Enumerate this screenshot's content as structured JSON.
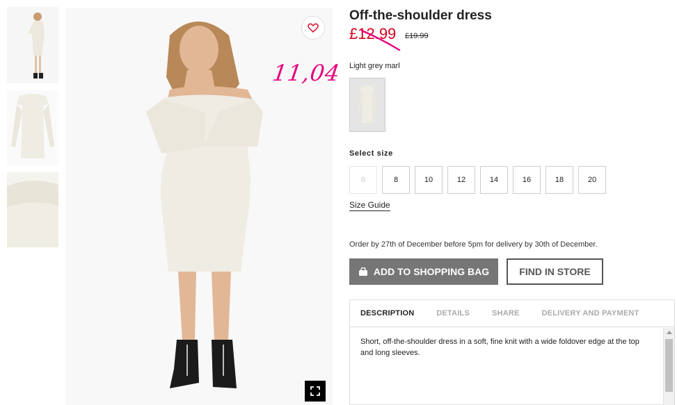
{
  "product": {
    "title": "Off-the-shoulder dress",
    "price_new": "£12.99",
    "price_old": "£19.99",
    "handwritten_note": "11,04",
    "color_label": "Light grey marl"
  },
  "sizes": {
    "label": "Select size",
    "options": [
      "6",
      "8",
      "10",
      "12",
      "14",
      "16",
      "18",
      "20"
    ],
    "guide": "Size Guide"
  },
  "delivery_note": "Order by 27th of December before 5pm for delivery by 30th of December.",
  "buttons": {
    "add_to_bag": "ADD TO SHOPPING BAG",
    "find_in_store": "FIND IN STORE"
  },
  "tabs": {
    "items": [
      "DESCRIPTION",
      "DETAILS",
      "SHARE",
      "DELIVERY AND PAYMENT"
    ],
    "active": "DESCRIPTION",
    "description": "Short, off-the-shoulder dress in a soft, fine knit with a wide foldover edge at the top and long sleeves."
  },
  "colors": {
    "price_red": "#d6001c",
    "annotation_pink": "#e6007e",
    "add_bag_gray": "#767676",
    "dress_cream": "#efece3"
  }
}
